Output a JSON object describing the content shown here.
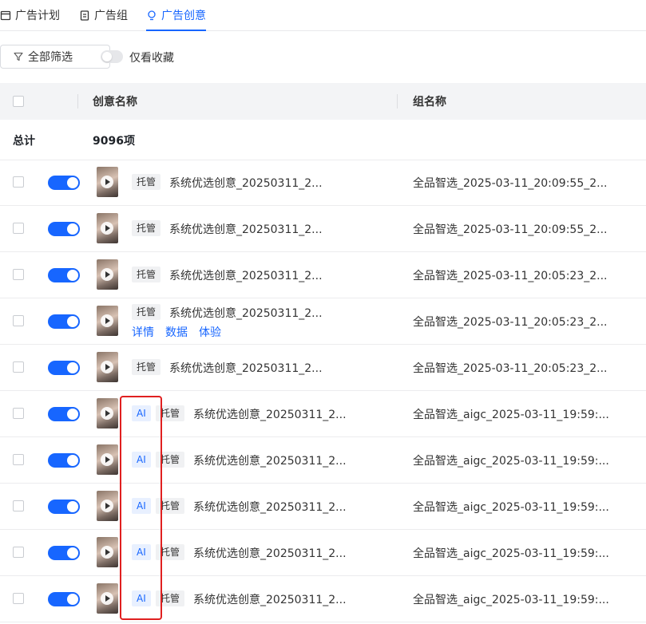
{
  "tabs": [
    {
      "label": "广告计划",
      "icon": "calendar-icon",
      "active": false
    },
    {
      "label": "广告组",
      "icon": "clipboard-icon",
      "active": false
    },
    {
      "label": "广告创意",
      "icon": "lightbulb-icon",
      "active": true
    }
  ],
  "toolbar": {
    "filter_label": "全部筛选",
    "favorites_label": "仅看收藏",
    "favorites_on": false
  },
  "table": {
    "headers": {
      "name": "创意名称",
      "group": "组名称"
    },
    "total_label": "总计",
    "total_count": "9096项",
    "row_links": [
      "详情",
      "数据",
      "体验"
    ],
    "rows": [
      {
        "ai": false,
        "tag": "托管",
        "name": "系统优选创意_20250311_2...",
        "group": "全品智选_2025-03-11_20:09:55_2..."
      },
      {
        "ai": false,
        "tag": "托管",
        "name": "系统优选创意_20250311_2...",
        "group": "全品智选_2025-03-11_20:09:55_2..."
      },
      {
        "ai": false,
        "tag": "托管",
        "name": "系统优选创意_20250311_2...",
        "group": "全品智选_2025-03-11_20:05:23_2..."
      },
      {
        "ai": false,
        "tag": "托管",
        "name": "系统优选创意_20250311_2...",
        "group": "全品智选_2025-03-11_20:05:23_2...",
        "show_links": true
      },
      {
        "ai": false,
        "tag": "托管",
        "name": "系统优选创意_20250311_2...",
        "group": "全品智选_2025-03-11_20:05:23_2..."
      },
      {
        "ai": true,
        "ai_label": "AI",
        "tag": "托管",
        "name": "系统优选创意_20250311_2...",
        "group": "全品智选_aigc_2025-03-11_19:59:..."
      },
      {
        "ai": true,
        "ai_label": "AI",
        "tag": "托管",
        "name": "系统优选创意_20250311_2...",
        "group": "全品智选_aigc_2025-03-11_19:59:..."
      },
      {
        "ai": true,
        "ai_label": "AI",
        "tag": "托管",
        "name": "系统优选创意_20250311_2...",
        "group": "全品智选_aigc_2025-03-11_19:59:..."
      },
      {
        "ai": true,
        "ai_label": "AI",
        "tag": "托管",
        "name": "系统优选创意_20250311_2...",
        "group": "全品智选_aigc_2025-03-11_19:59:..."
      },
      {
        "ai": true,
        "ai_label": "AI",
        "tag": "托管",
        "name": "系统优选创意_20250311_2...",
        "group": "全品智选_aigc_2025-03-11_19:59:..."
      }
    ]
  },
  "colors": {
    "accent": "#1766ff",
    "highlight": "#e02020"
  }
}
